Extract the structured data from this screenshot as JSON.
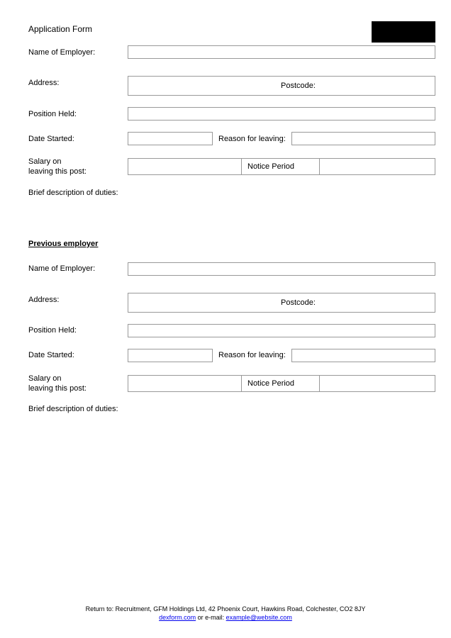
{
  "title": "Application Form",
  "labels": {
    "name_of_employer": "Name of Employer:",
    "address": "Address:",
    "postcode": "Postcode:",
    "position_held": "Position Held:",
    "date_started": "Date Started:",
    "reason_for_leaving": "Reason for leaving:",
    "salary_line1": "Salary on",
    "salary_line2": "leaving this post:",
    "notice_period": "Notice Period",
    "brief_description": "Brief description of duties:",
    "previous_employer": "Previous employer"
  },
  "footer": {
    "line1": "Return to: Recruitment, GFM Holdings Ltd, 42 Phoenix Court, Hawkins Road, Colchester, CO2 8JY",
    "link1_text": "dexform.com",
    "mid_text": "  or e-mail: ",
    "link2_text": "example@website.com"
  }
}
